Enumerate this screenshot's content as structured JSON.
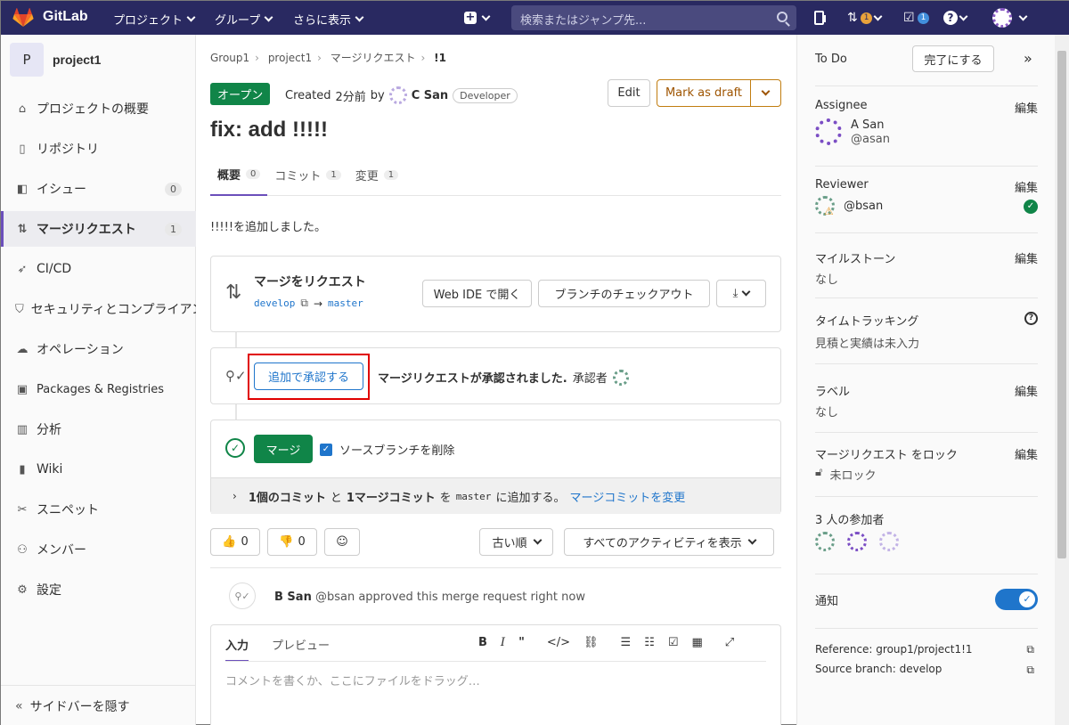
{
  "topbar": {
    "brand": "GitLab",
    "nav": [
      "プロジェクト",
      "グループ",
      "さらに表示"
    ],
    "search_placeholder": "検索またはジャンプ先...",
    "mr_count": "1",
    "todo_count": "1"
  },
  "sidebar": {
    "project_initial": "P",
    "project_name": "project1",
    "items": [
      {
        "label": "プロジェクトの概要",
        "icon": "home-icon"
      },
      {
        "label": "リポジトリ",
        "icon": "file-icon"
      },
      {
        "label": "イシュー",
        "icon": "issues-icon",
        "count": "0"
      },
      {
        "label": "マージリクエスト",
        "icon": "merge-request-icon",
        "count": "1"
      },
      {
        "label": "CI/CD",
        "icon": "rocket-icon"
      },
      {
        "label": "セキュリティとコンプライアンス",
        "icon": "shield-icon"
      },
      {
        "label": "オペレーション",
        "icon": "cloud-icon"
      },
      {
        "label": "Packages & Registries",
        "icon": "package-icon"
      },
      {
        "label": "分析",
        "icon": "chart-icon"
      },
      {
        "label": "Wiki",
        "icon": "book-icon"
      },
      {
        "label": "スニペット",
        "icon": "scissors-icon"
      },
      {
        "label": "メンバー",
        "icon": "users-icon"
      },
      {
        "label": "設定",
        "icon": "gear-icon"
      }
    ],
    "hide": "サイドバーを隠す"
  },
  "breadcrumb": [
    "Group1",
    "project1",
    "マージリクエスト",
    "!1"
  ],
  "mr": {
    "status": "オープン",
    "created": "Created",
    "ago": "2分前",
    "by": "by",
    "author": "C San",
    "role": "Developer",
    "edit": "Edit",
    "draft": "Mark as draft",
    "title": "fix: add !!!!!",
    "tabs": [
      {
        "label": "概要",
        "count": "0"
      },
      {
        "label": "コミット",
        "count": "1"
      },
      {
        "label": "変更",
        "count": "1"
      }
    ],
    "description": "!!!!!を追加しました。"
  },
  "widget": {
    "heading": "マージをリクエスト",
    "source": "develop",
    "target": "master",
    "arrow": "→",
    "webide": "Web IDE で開く",
    "checkout": "ブランチのチェックアウト",
    "approve_btn": "追加で承認する",
    "approved_text": "マージリクエストが承認されました.",
    "approver_label": "承認者",
    "merge_btn": "マージ",
    "delete_branch": "ソースブランチを削除",
    "commits_a": "1個のコミット",
    "commits_and": "と",
    "commits_b": "1マージコミット",
    "commits_to": "を",
    "commits_branch": "master",
    "commits_add": "に追加する。",
    "modify_link": "マージコミットを変更"
  },
  "reactions": {
    "up": "0",
    "down": "0",
    "sort": "古い順",
    "filter": "すべてのアクティビティを表示"
  },
  "activity": {
    "user": "B San",
    "handle": "@bsan",
    "text": "approved this merge request right now"
  },
  "editor": {
    "tab_write": "入力",
    "tab_preview": "プレビュー",
    "placeholder": "コメントを書くか、ここにファイルをドラッグ…"
  },
  "right": {
    "todo": "To Do",
    "done_btn": "完了にする",
    "edit": "編集",
    "assignee_h": "Assignee",
    "assignee_name": "A San",
    "assignee_handle": "@asan",
    "reviewer_h": "Reviewer",
    "reviewer_handle": "@bsan",
    "milestone_h": "マイルストーン",
    "milestone_v": "なし",
    "time_h": "タイムトラッキング",
    "time_v": "見積と実績は未入力",
    "label_h": "ラベル",
    "label_v": "なし",
    "lock_h": "マージリクエスト をロック",
    "lock_v": "未ロック",
    "participants": "3 人の参加者",
    "notify": "通知",
    "reference": "Reference: group1/project1!1",
    "source_branch": "Source branch: develop"
  },
  "colors": {
    "brand": "#292961",
    "accent": "#6b4fbb",
    "success": "#108548",
    "link": "#1f75cb",
    "highlight": "#e00000"
  }
}
